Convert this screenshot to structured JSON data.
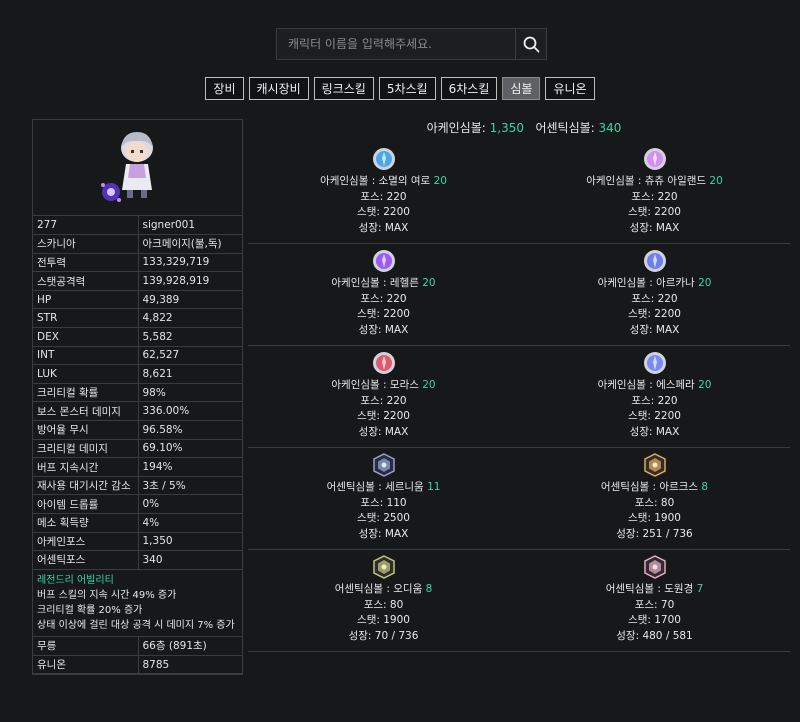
{
  "search": {
    "placeholder": "캐릭터 이름을 입력해주세요."
  },
  "tabs": [
    "장비",
    "캐시장비",
    "링크스킬",
    "5차스킬",
    "6차스킬",
    "심볼",
    "유니온"
  ],
  "active_tab": "심볼",
  "character": {
    "level": "277",
    "name": "signer001",
    "stats": [
      {
        "k": "스카니아",
        "v": "아크메이지(불,독)"
      },
      {
        "k": "전투력",
        "v": "133,329,719"
      },
      {
        "k": "스탯공격력",
        "v": "139,928,919"
      },
      {
        "k": "HP",
        "v": "49,389"
      },
      {
        "k": "STR",
        "v": "4,822"
      },
      {
        "k": "DEX",
        "v": "5,582"
      },
      {
        "k": "INT",
        "v": "62,527"
      },
      {
        "k": "LUK",
        "v": "8,621"
      },
      {
        "k": "크리티컬 확률",
        "v": "98%"
      },
      {
        "k": "보스 몬스터 데미지",
        "v": "336.00%"
      },
      {
        "k": "방어율 무시",
        "v": "96.58%"
      },
      {
        "k": "크리티컬 데미지",
        "v": "69.10%"
      },
      {
        "k": "버프 지속시간",
        "v": "194%"
      },
      {
        "k": "재사용 대기시간 감소",
        "v": "3초 / 5%"
      },
      {
        "k": "아이템 드롭률",
        "v": "0%"
      },
      {
        "k": "메소 획득량",
        "v": "4%"
      },
      {
        "k": "아케인포스",
        "v": "1,350"
      },
      {
        "k": "어센틱포스",
        "v": "340"
      }
    ],
    "legendary": {
      "title": "레전드리 어빌리티",
      "lines": [
        "버프 스킬의 지속 시간 49% 증가",
        "크리티컬 확률 20% 증가",
        "상태 이상에 걸린 대상 공격 시 데미지 7% 증가"
      ]
    },
    "tail": [
      {
        "k": "무릉",
        "v": "66층 (891초)"
      },
      {
        "k": "유니온",
        "v": "8785"
      }
    ]
  },
  "summary": {
    "arcane_label": "아케인심볼:",
    "arcane_value": "1,350",
    "authentic_label": "어센틱심볼:",
    "authentic_value": "340"
  },
  "symbols": [
    {
      "name": "아케인심볼 : 소멸의 여로",
      "level": "20",
      "force": "포스: 220",
      "stat": "스탯: 2200",
      "growth": "성장: MAX",
      "icon": "vanishing-journey-icon",
      "color": "#4aa8e8"
    },
    {
      "name": "아케인심볼 : 츄츄 아일랜드",
      "level": "20",
      "force": "포스: 220",
      "stat": "스탯: 2200",
      "growth": "성장: MAX",
      "icon": "chuchu-island-icon",
      "color": "#d48ef0"
    },
    {
      "name": "아케인심볼 : 레헬른",
      "level": "20",
      "force": "포스: 220",
      "stat": "스탯: 2200",
      "growth": "성장: MAX",
      "icon": "lachelein-icon",
      "color": "#9b5cf5"
    },
    {
      "name": "아케인심볼 : 아르카나",
      "level": "20",
      "force": "포스: 220",
      "stat": "스탯: 2200",
      "growth": "성장: MAX",
      "icon": "arcana-icon",
      "color": "#6f7ee8"
    },
    {
      "name": "아케인심볼 : 모라스",
      "level": "20",
      "force": "포스: 220",
      "stat": "스탯: 2200",
      "growth": "성장: MAX",
      "icon": "morass-icon",
      "color": "#e05a6e"
    },
    {
      "name": "아케인심볼 : 에스페라",
      "level": "20",
      "force": "포스: 220",
      "stat": "스탯: 2200",
      "growth": "성장: MAX",
      "icon": "esfera-icon",
      "color": "#7a8cf0"
    },
    {
      "name": "어센틱심볼 : 세르니움",
      "level": "11",
      "force": "포스: 110",
      "stat": "스탯: 2500",
      "growth": "성장: MAX",
      "icon": "cernium-icon",
      "color": "#8fa2d8"
    },
    {
      "name": "어센틱심볼 : 아르크스",
      "level": "8",
      "force": "포스: 80",
      "stat": "스탯: 1900",
      "growth": "성장: 251 / 736",
      "icon": "arcus-icon",
      "color": "#e8a84a"
    },
    {
      "name": "어센틱심볼 : 오디움",
      "level": "8",
      "force": "포스: 80",
      "stat": "스탯: 1900",
      "growth": "성장: 70 / 736",
      "icon": "odium-icon",
      "color": "#c9c46a"
    },
    {
      "name": "어센틱심볼 : 도원경",
      "level": "7",
      "force": "포스: 70",
      "stat": "스탯: 1700",
      "growth": "성장: 480 / 581",
      "icon": "shangri-la-icon",
      "color": "#e8a8b8"
    }
  ]
}
